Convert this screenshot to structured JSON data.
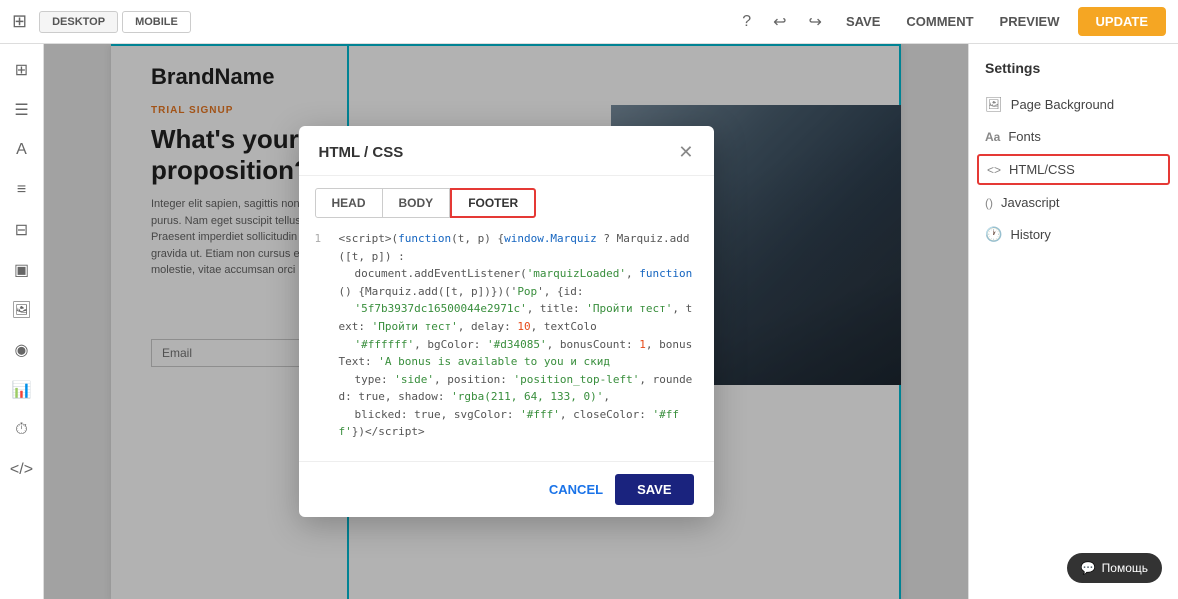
{
  "toolbar": {
    "desktop_label": "DESKTOP",
    "mobile_label": "MOBILE",
    "save_label": "SAVE",
    "comment_label": "COMMENT",
    "preview_label": "PREVIEW",
    "update_label": "UPDATE"
  },
  "settings": {
    "title": "Settings",
    "items": [
      {
        "id": "page-background",
        "icon": "🖼",
        "label": "Page Background"
      },
      {
        "id": "fonts",
        "icon": "Aa",
        "label": "Fonts"
      },
      {
        "id": "html-css",
        "icon": "<>",
        "label": "HTML/CSS",
        "active": true
      },
      {
        "id": "javascript",
        "icon": "()",
        "label": "Javascript"
      },
      {
        "id": "history",
        "icon": "🕐",
        "label": "History"
      }
    ]
  },
  "page": {
    "brand": "BrandName",
    "trial_label": "TRIAL SIGNUP",
    "heading": "What's your\nproposition?",
    "body_text": "Integer elit sapien, sagittis non le purus. Nam eget suscipit tellus, e Praesent imperdiet sollicitudin te gravida ut. Etiam non cursus eni molestie, vitae accumsan orci m",
    "email_placeholder": "Email"
  },
  "modal": {
    "title": "HTML / CSS",
    "tabs": [
      {
        "id": "head",
        "label": "HEAD"
      },
      {
        "id": "body",
        "label": "BODY"
      },
      {
        "id": "footer",
        "label": "FOOTER",
        "active": true
      }
    ],
    "code_line": "1",
    "code_content": "<script>(function(t, p) {window.Marquiz ? Marquiz.add([t, p]) : document.addEventListener('marquizLoaded', function() {Marquiz.add([t, p])})('Pop', {id: '5f7b3937dc16500044e2971c', title: 'Пройти тест', text: 'Пройти тест', delay: 10, textColor: '#ffffff', bgColor: '#d34085', bonusCount: 1, bonusText: 'A bonus is available to you и скидр type: 'side', position: 'position_top-left', rounded: true, shadow: 'rgba(211, 64, 133, 0)', blicked: true, svgColor: '#fff', closeColor: '#fff'})</script>",
    "cancel_label": "CANCEL",
    "save_label": "SAVE"
  },
  "help": {
    "label": "Помощь"
  }
}
